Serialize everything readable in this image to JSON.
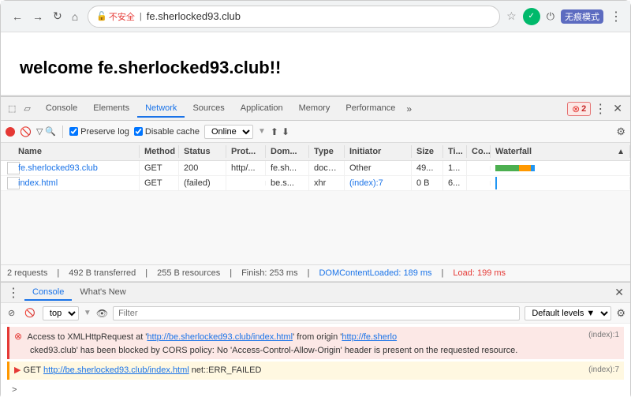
{
  "browser": {
    "back_label": "←",
    "forward_label": "→",
    "refresh_label": "↻",
    "home_label": "⌂",
    "security_label": "不安全",
    "url": "fe.sherlocked93.club",
    "star_label": "☆",
    "profile_check": "✓",
    "power_label": "⏻",
    "profile_label": "无痕模式",
    "menu_label": "⋮"
  },
  "page": {
    "title": "welcome fe.sherlocked93.club!!"
  },
  "devtools": {
    "tabs": [
      {
        "label": "Console",
        "active": false
      },
      {
        "label": "Elements",
        "active": false
      },
      {
        "label": "Network",
        "active": true
      },
      {
        "label": "Sources",
        "active": false
      },
      {
        "label": "Application",
        "active": false
      },
      {
        "label": "Memory",
        "active": false
      },
      {
        "label": "Performance",
        "active": false
      }
    ],
    "more_label": "»",
    "error_count": "2",
    "dots_label": "⋮",
    "close_label": "✕"
  },
  "network_toolbar": {
    "preserve_log": "Preserve log",
    "disable_cache": "Disable cache",
    "online_label": "Online",
    "settings_label": "⚙"
  },
  "table": {
    "headers": [
      "Name",
      "Method",
      "Status",
      "Prot...",
      "Dom...",
      "Type",
      "Initiator",
      "Size",
      "Ti...",
      "Co...",
      "Waterfall"
    ],
    "rows": [
      {
        "name": "fe.sherlocked93.club",
        "method": "GET",
        "status": "200",
        "prot": "http/...",
        "dom": "fe.sh...",
        "type": "docu...",
        "initiator": "Other",
        "size": "49...",
        "ti": "1...",
        "co": "",
        "name_class": "blue"
      },
      {
        "name": "index.html",
        "method": "GET",
        "status": "(failed)",
        "prot": "",
        "dom": "be.s...",
        "type": "xhr",
        "initiator": "(index):7",
        "size": "0 B",
        "ti": "6...",
        "co": "",
        "name_class": "blue",
        "method_class": "red",
        "status_class": "red",
        "initiator_class": "blue"
      }
    ]
  },
  "summary": {
    "requests": "2 requests",
    "transferred": "492 B transferred",
    "resources": "255 B resources",
    "finish": "Finish: 253 ms",
    "domcontentloaded": "DOMContentLoaded: 189 ms",
    "load": "Load: 199 ms"
  },
  "console": {
    "tabs": [
      {
        "label": "Console",
        "active": true
      },
      {
        "label": "What's New",
        "active": false
      }
    ],
    "close_label": "✕",
    "context": "top",
    "filter_placeholder": "Filter",
    "levels": "Default levels ▼",
    "settings_label": "⚙",
    "errors": [
      {
        "type": "error",
        "text": "Access to XMLHttpRequest at '",
        "url1": "http://be.sherlocked93.club/index.html",
        "mid1": "' from origin '",
        "url2": "http://fe.sherlo",
        "mid2": "(index):1",
        "end1": "cked93.club",
        "end2": "' has been blocked by CORS policy: No 'Access-Control-Allow-Origin' header is present on the requested resource.",
        "line": "(index):1"
      },
      {
        "type": "warning",
        "prefix": "▶ GET ",
        "url": "http://be.sherlocked93.club/index.html",
        "suffix": " net::ERR_FAILED",
        "line": "(index):7"
      }
    ]
  }
}
